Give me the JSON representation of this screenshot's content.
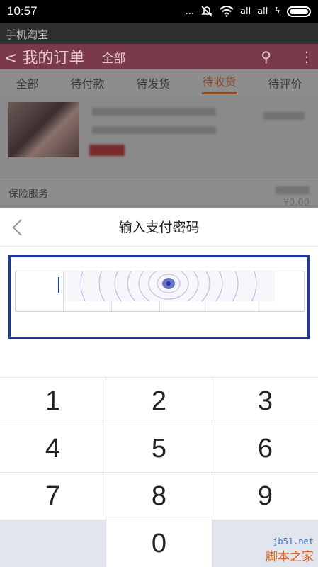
{
  "status_bar": {
    "time": "10:57",
    "dots": "...",
    "signal1": "all",
    "signal2": "all",
    "charging": "ϟ"
  },
  "app_title": "手机淘宝",
  "background_page": {
    "header_title": "< 我的订单",
    "header_filter": "全部",
    "tabs": [
      {
        "label": "全部"
      },
      {
        "label": "待付款"
      },
      {
        "label": "待发货"
      },
      {
        "label": "待收货"
      },
      {
        "label": "待评价"
      }
    ],
    "active_tab": "待收货",
    "insurance_label": "保险服务",
    "insurance_price": "¥0.00"
  },
  "pay_sheet": {
    "title": "输入支付密码",
    "back_icon": "chevron-left-icon",
    "keypad": [
      [
        "1",
        "2",
        "3"
      ],
      [
        "4",
        "5",
        "6"
      ],
      [
        "7",
        "8",
        "9"
      ],
      [
        "",
        "0",
        ""
      ]
    ]
  },
  "colors": {
    "frame": "#1b3c9a",
    "active_tab": "#8a4a2a",
    "keypad_blank": "#e1e6ee"
  },
  "watermark": {
    "site": "jb51.net",
    "name": "脚本之家"
  }
}
